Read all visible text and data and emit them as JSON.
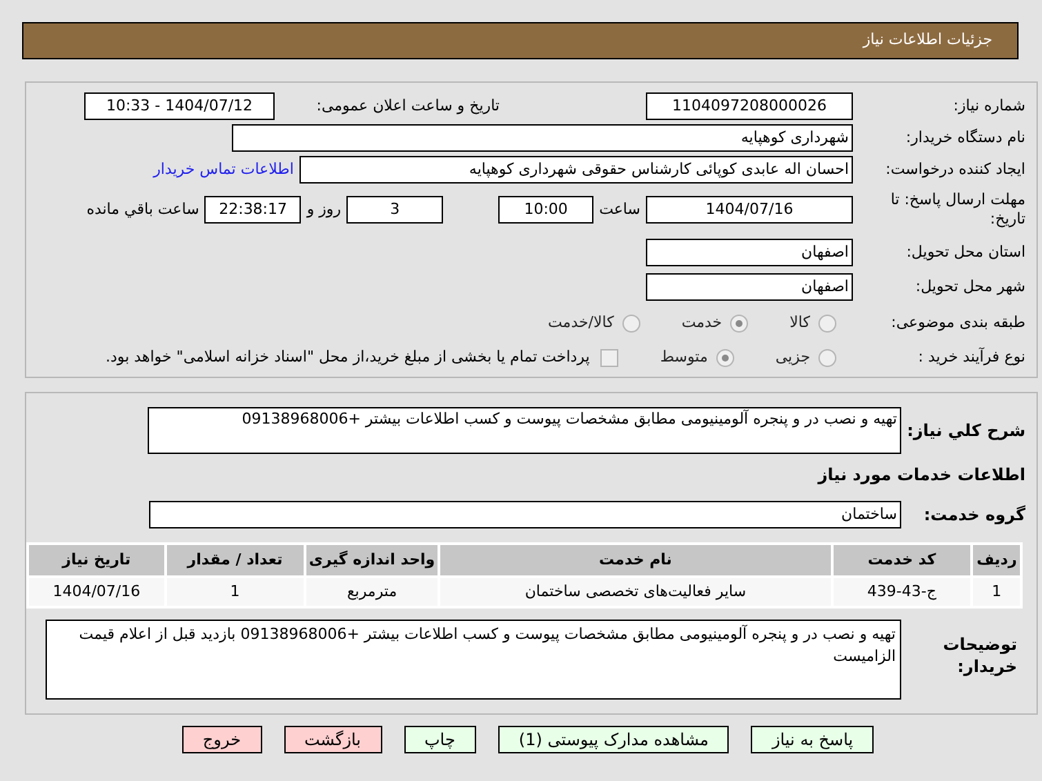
{
  "header": {
    "title": "جزئیات اطلاعات نیاز"
  },
  "details": {
    "need_number": {
      "label": "شماره نیاز:",
      "value": "1104097208000026"
    },
    "announce": {
      "label": "تاریخ و ساعت اعلان عمومی:",
      "value": "1404/07/12 - 10:33"
    },
    "buyer": {
      "label": "نام دستگاه خریدار:",
      "value": "شهرداری کوهپایه"
    },
    "requester": {
      "label": "ایجاد کننده درخواست:",
      "value": "احسان اله عابدی کوپائی کارشناس حقوقی شهرداری کوهپایه",
      "link": "اطلاعات تماس خریدار"
    },
    "deadline": {
      "label": "مهلت ارسال پاسخ: تا تاریخ:",
      "date": "1404/07/16",
      "time_label": "ساعت",
      "time": "10:00",
      "days": "3",
      "days_label": "روز و",
      "remaining": "22:38:17",
      "remaining_label": "ساعت باقي مانده"
    },
    "province": {
      "label": "استان محل تحویل:",
      "value": "اصفهان"
    },
    "city": {
      "label": "شهر محل تحویل:",
      "value": "اصفهان"
    },
    "category": {
      "label": "طبقه بندی موضوعی:",
      "options": [
        {
          "label": "کالا",
          "selected": false
        },
        {
          "label": "خدمت",
          "selected": true
        },
        {
          "label": "کالا/خدمت",
          "selected": false
        }
      ]
    },
    "process": {
      "label": "نوع فرآیند خرید :",
      "options": [
        {
          "label": "جزیی",
          "selected": false
        },
        {
          "label": "متوسط",
          "selected": true
        }
      ],
      "payment": {
        "label": "پرداخت تمام یا بخشی از مبلغ خرید،از محل \"اسناد خزانه اسلامی\" خواهد بود.",
        "checked": false
      }
    }
  },
  "description": {
    "label": "شرح کلي نياز:",
    "value": "تهیه و نصب در و پنجره آلومینیومی مطابق مشخصات پیوست و کسب اطلاعات بیشتر +09138968006"
  },
  "services_title": "اطلاعات خدمات مورد نیاز",
  "service_group": {
    "label": "گروه خدمت:",
    "value": "ساختمان"
  },
  "table": {
    "columns": [
      "ردیف",
      "کد خدمت",
      "نام خدمت",
      "واحد اندازه گیری",
      "تعداد / مقدار",
      "تاریخ نیاز"
    ],
    "rows": [
      [
        "1",
        "ج-43-439",
        "سایر فعالیت‌های تخصصی ساختمان",
        "مترمربع",
        "1",
        "1404/07/16"
      ]
    ]
  },
  "notes": {
    "label": "توضیحات خریدار:",
    "value": "تهیه و نصب در و پنجره آلومینیومی مطابق مشخصات پیوست و کسب اطلاعات بیشتر +09138968006 بازدید قبل از اعلام قیمت الزامیست"
  },
  "buttons": [
    {
      "label": "پاسخ به نیاز",
      "kind": "primary"
    },
    {
      "label": "مشاهده مدارک پیوستی (1)",
      "kind": "primary"
    },
    {
      "label": "چاپ",
      "kind": "primary"
    },
    {
      "label": "بازگشت",
      "kind": "danger"
    },
    {
      "label": "خروج",
      "kind": "danger"
    }
  ]
}
